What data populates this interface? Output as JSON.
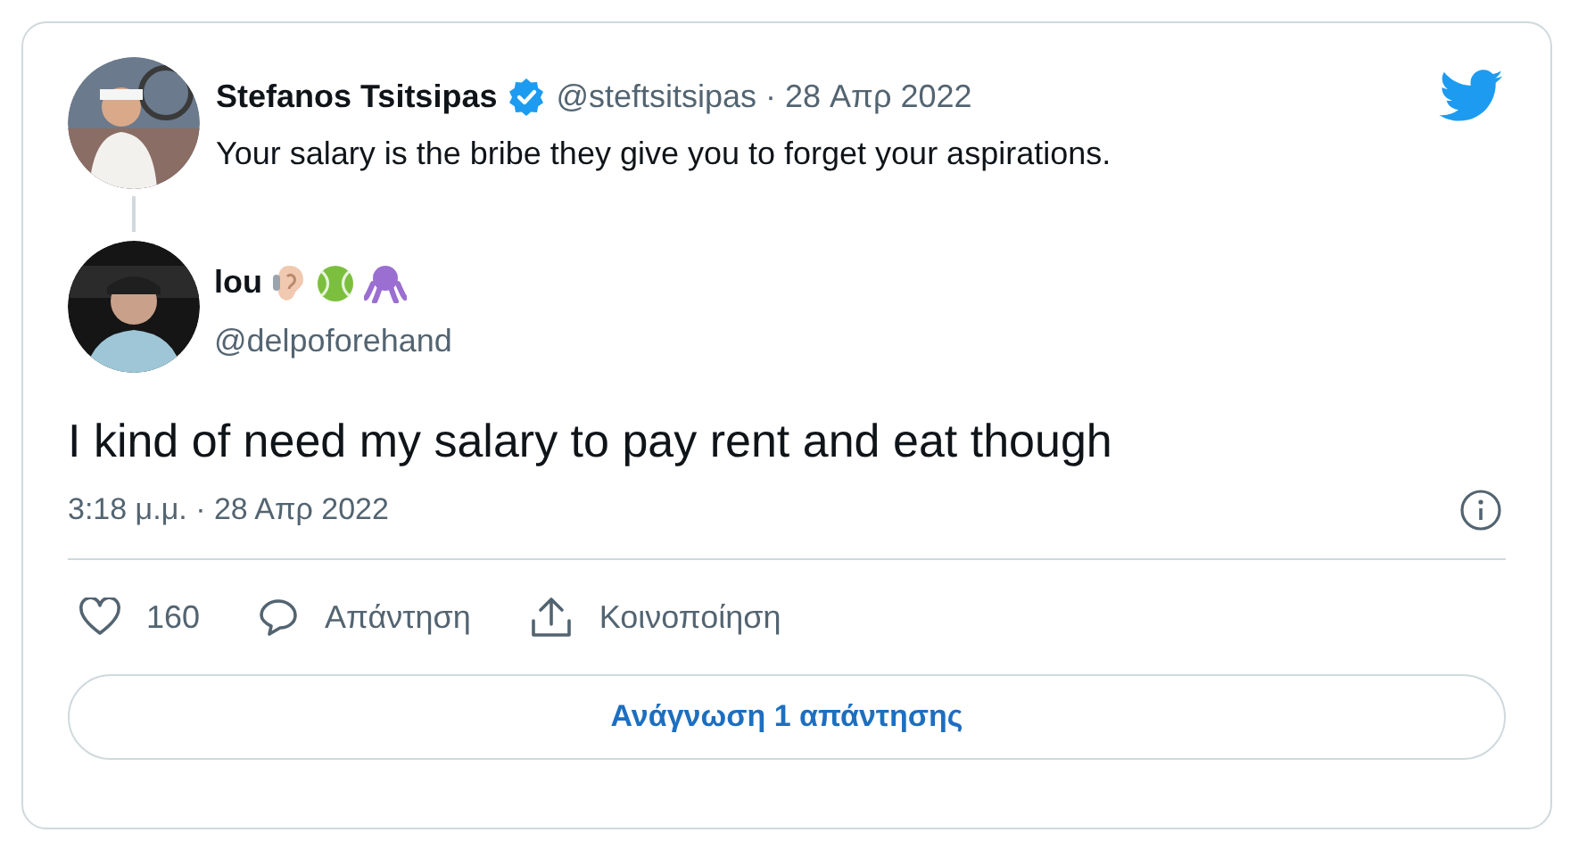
{
  "quoted_tweet": {
    "author_name": "Stefanos Tsitsipas",
    "verified": true,
    "handle_and_date": "@steftsitsipas · 28 Απρ 2022",
    "text": "Your salary is the bribe they give you to forget your aspirations."
  },
  "reply": {
    "author_name": "lou",
    "handle": "@delpoforehand",
    "text": "I kind of need my salary to pay rent and eat though",
    "timestamp": "3:18 μ.μ. · 28 Απρ 2022"
  },
  "actions": [
    {
      "kind": "like",
      "label": "160"
    },
    {
      "kind": "reply",
      "label": "Απάντηση"
    },
    {
      "kind": "share",
      "label": "Κοινοποίηση"
    }
  ],
  "read_replies_button": "Ανάγνωση 1 απάντησης"
}
